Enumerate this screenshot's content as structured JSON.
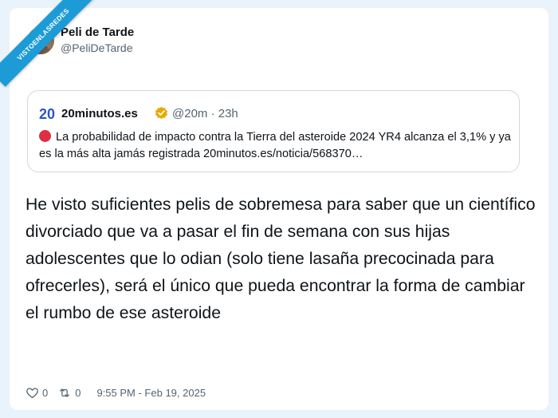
{
  "watermark": "VISTOENLASREDES",
  "author": {
    "name": "Peli de Tarde",
    "handle": "@PeliDeTarde"
  },
  "quoted": {
    "logo": "20",
    "name": "20minutos.es",
    "handle_time": "@20m · 23h",
    "text": "La probabilidad de impacto contra la Tierra del asteroide 2024 YR4 alcanza el 3,1% y ya es la más alta jamás registrada 20minutos.es/noticia/568370…"
  },
  "tweet_text": "He visto suficientes pelis de sobremesa para saber que un científico divorciado que va a pasar el fin de semana con sus hijas adolescentes que lo odian (solo tiene lasaña precocinada para ofrecerles), será el único que pueda encontrar la forma de cambiar el rumbo de ese asteroide",
  "footer": {
    "likes": "0",
    "retweets": "0",
    "timestamp": "9:55 PM - Feb 19, 2025"
  },
  "colors": {
    "accent": "#1d9bd6",
    "quote_red": "#dd2e44",
    "verified_gold": "#e8a800"
  },
  "icons": [
    "heart-icon",
    "retweet-icon",
    "verified-badge-icon",
    "red-circle-icon"
  ]
}
